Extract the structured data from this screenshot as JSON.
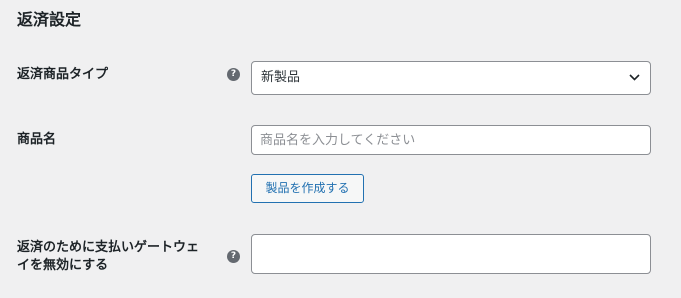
{
  "section": {
    "title": "返済設定"
  },
  "fields": {
    "refund_product_type": {
      "label": "返済商品タイプ",
      "help_icon": "question-mark-icon",
      "selected_value": "新製品",
      "dropdown_icon": "chevron-down-icon"
    },
    "product_name": {
      "label": "商品名",
      "value": "",
      "placeholder": "商品名を入力してください",
      "create_button_label": "製品を作成する"
    },
    "disable_gateway": {
      "label_line1": "返済のために支払いゲートウェ",
      "label_line2": "イを無効にする",
      "help_icon": "question-mark-icon",
      "value": ""
    }
  },
  "colors": {
    "background": "#f0f0f1",
    "accent": "#2271b1",
    "input_border": "#8c8f94",
    "help_icon": "#646970"
  }
}
